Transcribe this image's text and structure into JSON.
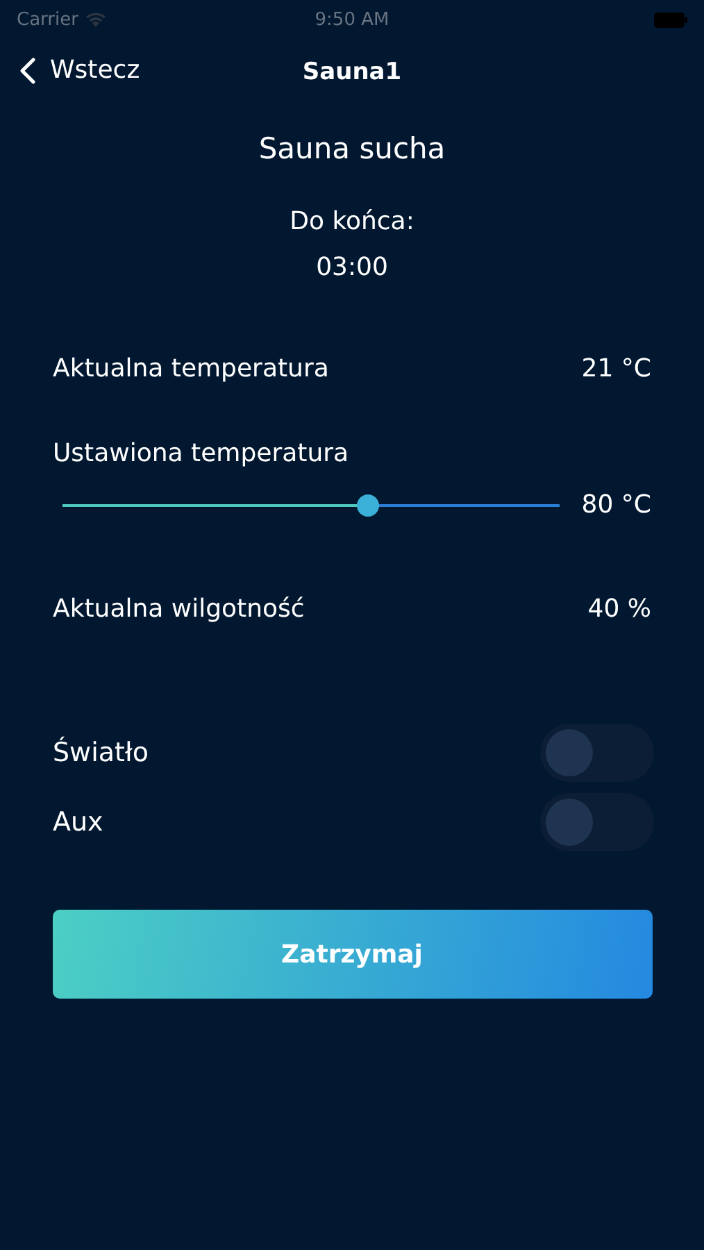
{
  "status_bar": {
    "carrier": "Carrier",
    "time": "9:50 AM"
  },
  "nav": {
    "back": "Wstecz",
    "title": "Sauna1"
  },
  "mode": "Sauna sucha",
  "timer": {
    "label": "Do końca:",
    "value": "03:00"
  },
  "current_temperature": {
    "label": "Aktualna temperatura",
    "value": "21 °C"
  },
  "set_temperature": {
    "label": "Ustawiona temperatura",
    "level": 0.62,
    "value": "80 °C"
  },
  "current_humidity": {
    "label": "Aktualna wilgotność",
    "value": "40 %"
  },
  "toggles": [
    {
      "label": "Światło",
      "on": false
    },
    {
      "label": "Aux",
      "on": false
    }
  ],
  "stop_button": "Zatrzymaj"
}
